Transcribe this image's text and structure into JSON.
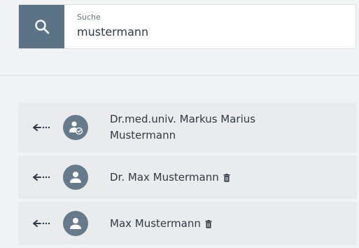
{
  "search": {
    "label": "Suche",
    "value": "mustermann",
    "icon": "search-icon"
  },
  "results": [
    {
      "name": "Dr.med.univ. Markus Marius Mustermann",
      "avatar": "user-verified-icon",
      "deletable": false
    },
    {
      "name": "Dr. Max Mustermann",
      "avatar": "user-icon",
      "deletable": true
    },
    {
      "name": "Max Mustermann",
      "avatar": "user-icon",
      "deletable": true
    }
  ],
  "colors": {
    "accent": "#5c7285",
    "avatar": "#667a8c",
    "row_bg": "#e9ebed",
    "page_bg": "#f2f3f4"
  }
}
